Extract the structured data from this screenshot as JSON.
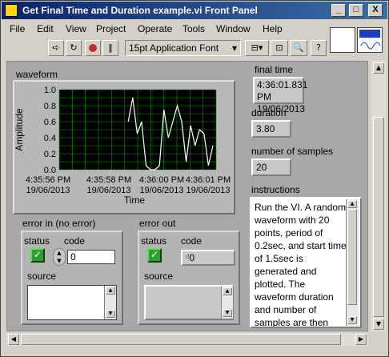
{
  "window": {
    "title": "Get Final Time and Duration example.vi Front Panel",
    "buttons": {
      "minimize": "_",
      "maximize": "□",
      "close": "X"
    }
  },
  "menu": [
    "File",
    "Edit",
    "View",
    "Project",
    "Operate",
    "Tools",
    "Window",
    "Help"
  ],
  "toolbar": {
    "run_icon": "run-arrow-icon",
    "font": "15pt Application Font"
  },
  "waveform": {
    "label": "waveform",
    "ylabel": "Amplitude",
    "xlabel": "Time",
    "ytick_labels": [
      "1.0",
      "0.8",
      "0.6",
      "0.4",
      "0.2",
      "0.0"
    ],
    "xtick_labels": [
      {
        "time": "4:35:56 PM",
        "date": "19/06/2013"
      },
      {
        "time": "4:35:58 PM",
        "date": "19/06/2013"
      },
      {
        "time": "4:36:00 PM",
        "date": "19/06/2013"
      },
      {
        "time": "4:36:01 PM",
        "date": "19/06/2013"
      }
    ]
  },
  "chart_data": {
    "type": "line",
    "title": "waveform",
    "xlabel": "Time",
    "ylabel": "Amplitude",
    "ylim": [
      0,
      1
    ],
    "x_start_sec": 1.5,
    "dt": 0.2,
    "series": [
      {
        "values": [
          0.6,
          0.9,
          0.45,
          0.6,
          0.05,
          0.0,
          0.0,
          0.05,
          0.75,
          0.4,
          0.6,
          0.8,
          0.6,
          0.1,
          0.55,
          0.3,
          0.5,
          0.45,
          0.05,
          0.3
        ]
      }
    ],
    "grid": true,
    "plot_bg": "#000000",
    "line_color": "#ffffff",
    "grid_color": "#00a000"
  },
  "final_time": {
    "label": "final time",
    "value_line1": "4:36:01.831 PM",
    "value_line2": "19/06/2013"
  },
  "duration": {
    "label": "duration",
    "value": "3.80"
  },
  "num_samples": {
    "label": "number of samples",
    "value": "20"
  },
  "instructions": {
    "label": "instructions",
    "text": "Run the VI.  A random waveform with 20 points, period of 0.2sec, and start time of 1.5sec is generated and plotted.  The waveform duration and number of samples are then calculated and"
  },
  "error_in": {
    "label": "error in (no error)",
    "status_label": "status",
    "code_label": "code",
    "code_value": "0",
    "source_label": "source"
  },
  "error_out": {
    "label": "error out",
    "status_label": "status",
    "code_label": "code",
    "code_value": "0",
    "source_label": "source"
  },
  "colors": {
    "titlebar": "#0a246a",
    "panel": "#a8a8a8",
    "status_ok": "#2ea02e"
  }
}
